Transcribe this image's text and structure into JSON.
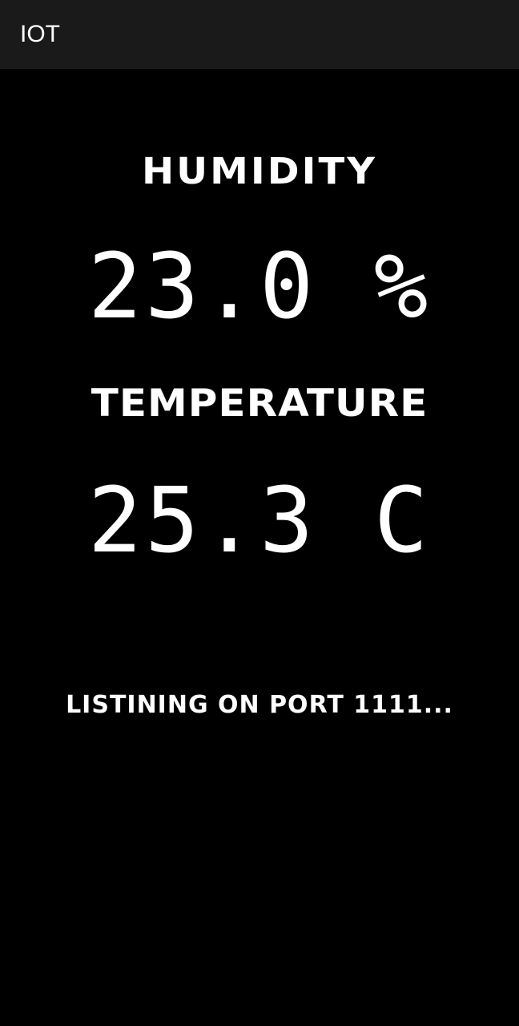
{
  "app_bar": {
    "title": "IOT"
  },
  "humidity": {
    "label": "HUMIDITY",
    "value": "23.0 %"
  },
  "temperature": {
    "label": "TEMPERATURE",
    "value": "25.3 C"
  },
  "status": {
    "text": "LISTINING ON PORT 1111..."
  },
  "colors": {
    "background": "#000000",
    "app_bar": "#1a1a1a",
    "text": "#ffffff"
  }
}
